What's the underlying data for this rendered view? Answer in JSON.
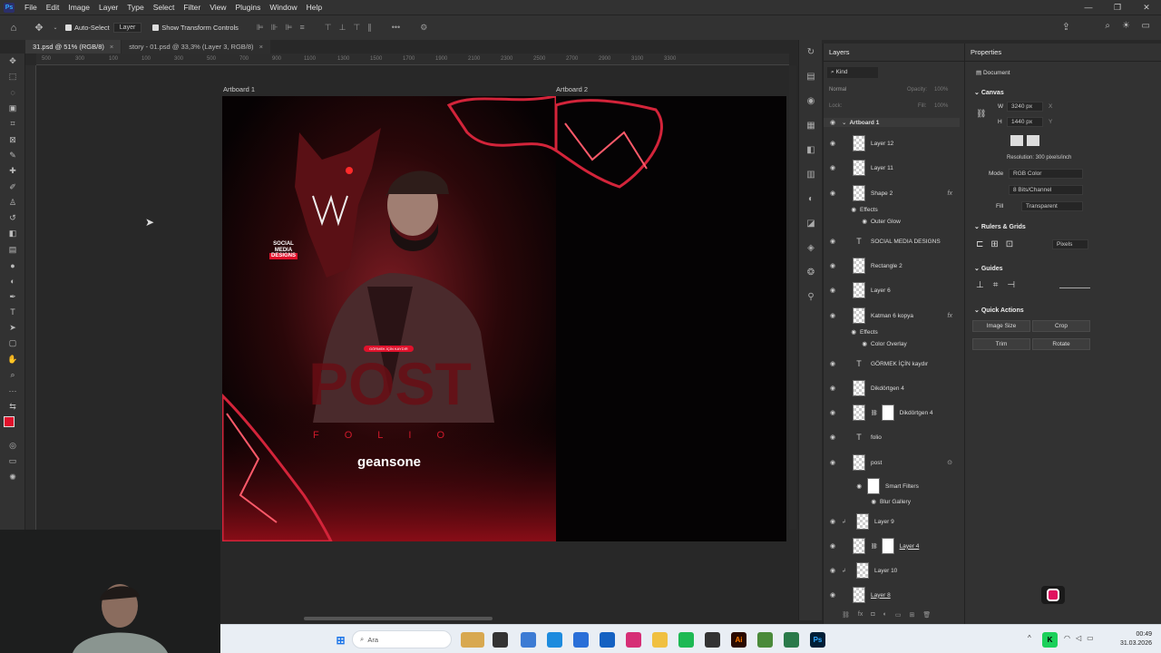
{
  "menu": [
    "File",
    "Edit",
    "Image",
    "Layer",
    "Type",
    "Select",
    "Filter",
    "View",
    "Plugins",
    "Window",
    "Help"
  ],
  "options": {
    "auto_select": "Auto-Select",
    "layer_select": "Layer",
    "transform_controls": "Show Transform Controls"
  },
  "tabs": [
    {
      "label": "31.psd @ 51% (RGB/8)"
    },
    {
      "label": "story - 01.psd @ 33,3% (Layer 3, RGB/8)"
    }
  ],
  "ruler_ticks": [
    "500",
    "300",
    "100",
    "100",
    "300",
    "500",
    "700",
    "900",
    "1100",
    "1300",
    "1500",
    "1700",
    "1900",
    "2100",
    "2300",
    "2500",
    "2700",
    "2900",
    "3100",
    "3300"
  ],
  "artboards": {
    "a1": "Artboard 1",
    "a2": "Artboard 2"
  },
  "artwork": {
    "social": "SOCIAL",
    "media": "MEDIA",
    "designs": "DESIGNS",
    "pill": "GÖRMEK İÇİN KAYDIR",
    "post": "POST",
    "folio": "FOLIO",
    "brand": "geansone"
  },
  "layers_panel": {
    "title": "Layers",
    "kind": "Kind",
    "blend": "Normal",
    "opacity_label": "Opacity:",
    "opacity": "100%",
    "lock_label": "Lock:",
    "fill_label": "Fill:",
    "fill": "100%",
    "items": [
      {
        "name": "Artboard 1"
      },
      {
        "name": "Layer 12"
      },
      {
        "name": "Layer 11"
      },
      {
        "name": "Shape 2"
      },
      {
        "name": "Effects"
      },
      {
        "name": "Outer Glow"
      },
      {
        "name": "SOCIAL MEDIA DESIGNS"
      },
      {
        "name": "Rectangle 2"
      },
      {
        "name": "Layer 6"
      },
      {
        "name": "Katman 6 kopya"
      },
      {
        "name": "Effects"
      },
      {
        "name": "Color Overlay"
      },
      {
        "name": "GÖRMEK İÇİN kaydır"
      },
      {
        "name": "Dikdörtgen 4"
      },
      {
        "name": "Dikdörtgen 4"
      },
      {
        "name": "folio"
      },
      {
        "name": "post"
      },
      {
        "name": "Smart Filters"
      },
      {
        "name": "Blur Gallery"
      },
      {
        "name": "Layer 9"
      },
      {
        "name": "Layer 4"
      },
      {
        "name": "Layer 10"
      },
      {
        "name": "Layer 8"
      }
    ]
  },
  "properties": {
    "title": "Properties",
    "doc": "Document",
    "canvas": "Canvas",
    "w_label": "W",
    "w": "3240 px",
    "h_label": "H",
    "h": "1440 px",
    "x_label": "X",
    "y_label": "Y",
    "resolution": "Resolution: 300 pixels/inch",
    "mode_label": "Mode",
    "mode": "RGB Color",
    "bits": "8 Bits/Channel",
    "fill_label": "Fill",
    "fill": "Transparent",
    "rulers": "Rulers & Grids",
    "units": "Pixels",
    "guides": "Guides",
    "quick": "Quick Actions",
    "btn_image_size": "Image Size",
    "btn_crop": "Crop",
    "btn_trim": "Trim",
    "btn_rotate": "Rotate"
  },
  "taskbar": {
    "search": "Ara",
    "time": "00:49",
    "date": "31.03.2026"
  },
  "colors": {
    "accent": "#e0112b",
    "bg": "#282828",
    "panel": "#323232"
  }
}
